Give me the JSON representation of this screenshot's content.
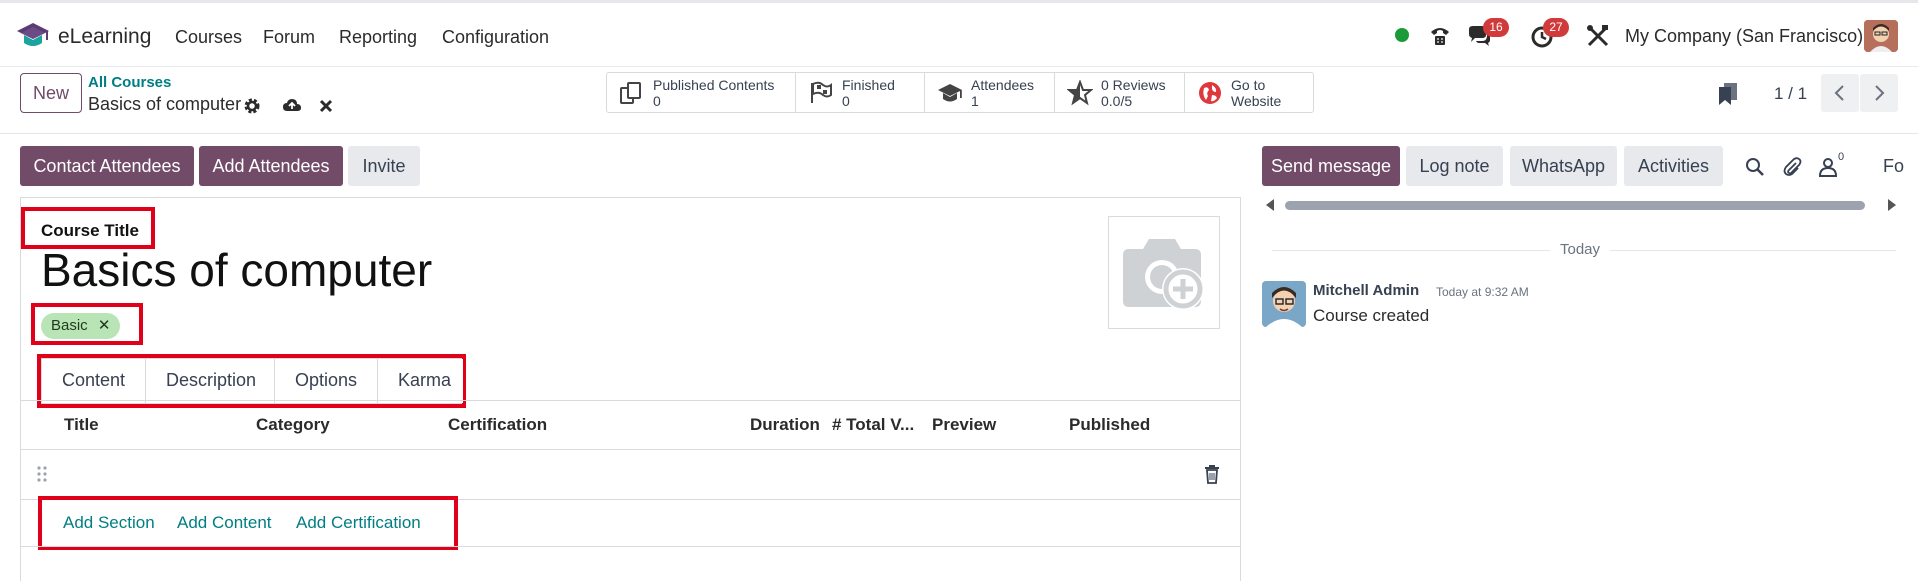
{
  "navbar": {
    "app_name": "eLearning",
    "menu": [
      "Courses",
      "Forum",
      "Reporting",
      "Configuration"
    ],
    "messages_badge": "16",
    "activities_badge": "27",
    "company": "My Company (San Francisco)"
  },
  "control_panel": {
    "new_label": "New",
    "breadcrumb_parent": "All Courses",
    "breadcrumb_current": "Basics of computer",
    "stats": [
      {
        "icon": "documents-icon",
        "label": "Published Contents",
        "value": "0"
      },
      {
        "icon": "flag-icon",
        "label": "Finished",
        "value": "0"
      },
      {
        "icon": "graduation-cap-icon",
        "label": "Attendees",
        "value": "1"
      },
      {
        "icon": "star-icon",
        "label": "0 Reviews",
        "value": "0.0/5"
      },
      {
        "icon": "globe-icon",
        "label": "Go to",
        "value": "Website"
      }
    ],
    "pager": "1 / 1"
  },
  "actions": {
    "contact_attendees": "Contact Attendees",
    "add_attendees": "Add Attendees",
    "invite": "Invite"
  },
  "form": {
    "course_title_label": "Course Title",
    "course_title": "Basics of computer",
    "tags": [
      "Basic"
    ],
    "tabs": [
      "Content",
      "Description",
      "Options",
      "Karma"
    ],
    "columns": [
      "Title",
      "Category",
      "Certification",
      "Duration",
      "# Total V...",
      "Preview",
      "Published"
    ],
    "add_links": [
      "Add Section",
      "Add Content",
      "Add Certification"
    ]
  },
  "chatter": {
    "send_message": "Send message",
    "log_note": "Log note",
    "whatsapp": "WhatsApp",
    "activities": "Activities",
    "followers_count": "0",
    "follow_label": "Fo",
    "date_separator": "Today",
    "messages": [
      {
        "author": "Mitchell Admin",
        "time": "Today at 9:32 AM",
        "body": "Course created"
      }
    ]
  },
  "colors": {
    "primary": "#714b67",
    "link": "#017e84",
    "highlight": "#e1001a",
    "badge": "#d13a3a",
    "tag": "#b9e4b5"
  }
}
